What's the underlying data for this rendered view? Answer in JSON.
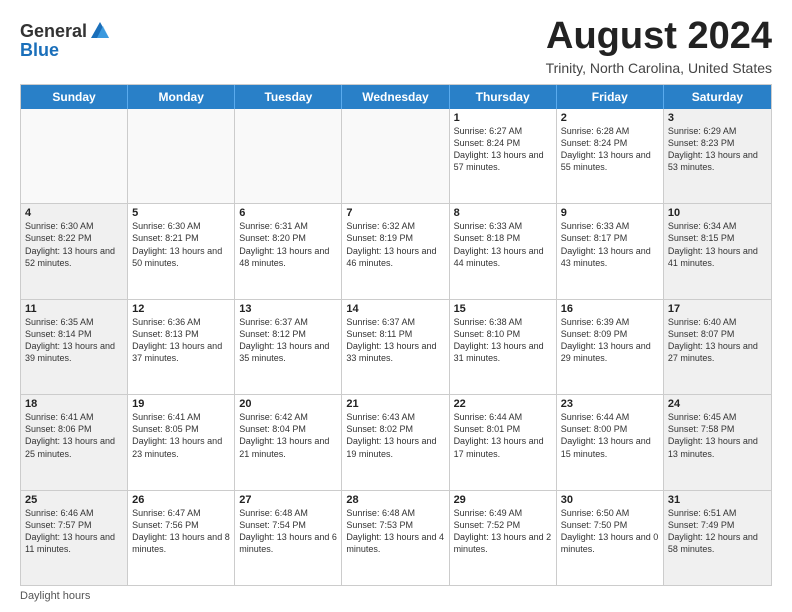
{
  "header": {
    "logo_line1": "General",
    "logo_line2": "Blue",
    "month_title": "August 2024",
    "location": "Trinity, North Carolina, United States"
  },
  "days_of_week": [
    "Sunday",
    "Monday",
    "Tuesday",
    "Wednesday",
    "Thursday",
    "Friday",
    "Saturday"
  ],
  "footer": {
    "daylight_label": "Daylight hours"
  },
  "weeks": [
    [
      {
        "day": "",
        "empty": true
      },
      {
        "day": "",
        "empty": true
      },
      {
        "day": "",
        "empty": true
      },
      {
        "day": "",
        "empty": true
      },
      {
        "day": "1",
        "sunrise": "Sunrise: 6:27 AM",
        "sunset": "Sunset: 8:24 PM",
        "daylight": "Daylight: 13 hours and 57 minutes."
      },
      {
        "day": "2",
        "sunrise": "Sunrise: 6:28 AM",
        "sunset": "Sunset: 8:24 PM",
        "daylight": "Daylight: 13 hours and 55 minutes."
      },
      {
        "day": "3",
        "sunrise": "Sunrise: 6:29 AM",
        "sunset": "Sunset: 8:23 PM",
        "daylight": "Daylight: 13 hours and 53 minutes.",
        "shaded": true
      }
    ],
    [
      {
        "day": "4",
        "sunrise": "Sunrise: 6:30 AM",
        "sunset": "Sunset: 8:22 PM",
        "daylight": "Daylight: 13 hours and 52 minutes.",
        "shaded": true
      },
      {
        "day": "5",
        "sunrise": "Sunrise: 6:30 AM",
        "sunset": "Sunset: 8:21 PM",
        "daylight": "Daylight: 13 hours and 50 minutes."
      },
      {
        "day": "6",
        "sunrise": "Sunrise: 6:31 AM",
        "sunset": "Sunset: 8:20 PM",
        "daylight": "Daylight: 13 hours and 48 minutes."
      },
      {
        "day": "7",
        "sunrise": "Sunrise: 6:32 AM",
        "sunset": "Sunset: 8:19 PM",
        "daylight": "Daylight: 13 hours and 46 minutes."
      },
      {
        "day": "8",
        "sunrise": "Sunrise: 6:33 AM",
        "sunset": "Sunset: 8:18 PM",
        "daylight": "Daylight: 13 hours and 44 minutes."
      },
      {
        "day": "9",
        "sunrise": "Sunrise: 6:33 AM",
        "sunset": "Sunset: 8:17 PM",
        "daylight": "Daylight: 13 hours and 43 minutes."
      },
      {
        "day": "10",
        "sunrise": "Sunrise: 6:34 AM",
        "sunset": "Sunset: 8:15 PM",
        "daylight": "Daylight: 13 hours and 41 minutes.",
        "shaded": true
      }
    ],
    [
      {
        "day": "11",
        "sunrise": "Sunrise: 6:35 AM",
        "sunset": "Sunset: 8:14 PM",
        "daylight": "Daylight: 13 hours and 39 minutes.",
        "shaded": true
      },
      {
        "day": "12",
        "sunrise": "Sunrise: 6:36 AM",
        "sunset": "Sunset: 8:13 PM",
        "daylight": "Daylight: 13 hours and 37 minutes."
      },
      {
        "day": "13",
        "sunrise": "Sunrise: 6:37 AM",
        "sunset": "Sunset: 8:12 PM",
        "daylight": "Daylight: 13 hours and 35 minutes."
      },
      {
        "day": "14",
        "sunrise": "Sunrise: 6:37 AM",
        "sunset": "Sunset: 8:11 PM",
        "daylight": "Daylight: 13 hours and 33 minutes."
      },
      {
        "day": "15",
        "sunrise": "Sunrise: 6:38 AM",
        "sunset": "Sunset: 8:10 PM",
        "daylight": "Daylight: 13 hours and 31 minutes."
      },
      {
        "day": "16",
        "sunrise": "Sunrise: 6:39 AM",
        "sunset": "Sunset: 8:09 PM",
        "daylight": "Daylight: 13 hours and 29 minutes."
      },
      {
        "day": "17",
        "sunrise": "Sunrise: 6:40 AM",
        "sunset": "Sunset: 8:07 PM",
        "daylight": "Daylight: 13 hours and 27 minutes.",
        "shaded": true
      }
    ],
    [
      {
        "day": "18",
        "sunrise": "Sunrise: 6:41 AM",
        "sunset": "Sunset: 8:06 PM",
        "daylight": "Daylight: 13 hours and 25 minutes.",
        "shaded": true
      },
      {
        "day": "19",
        "sunrise": "Sunrise: 6:41 AM",
        "sunset": "Sunset: 8:05 PM",
        "daylight": "Daylight: 13 hours and 23 minutes."
      },
      {
        "day": "20",
        "sunrise": "Sunrise: 6:42 AM",
        "sunset": "Sunset: 8:04 PM",
        "daylight": "Daylight: 13 hours and 21 minutes."
      },
      {
        "day": "21",
        "sunrise": "Sunrise: 6:43 AM",
        "sunset": "Sunset: 8:02 PM",
        "daylight": "Daylight: 13 hours and 19 minutes."
      },
      {
        "day": "22",
        "sunrise": "Sunrise: 6:44 AM",
        "sunset": "Sunset: 8:01 PM",
        "daylight": "Daylight: 13 hours and 17 minutes."
      },
      {
        "day": "23",
        "sunrise": "Sunrise: 6:44 AM",
        "sunset": "Sunset: 8:00 PM",
        "daylight": "Daylight: 13 hours and 15 minutes."
      },
      {
        "day": "24",
        "sunrise": "Sunrise: 6:45 AM",
        "sunset": "Sunset: 7:58 PM",
        "daylight": "Daylight: 13 hours and 13 minutes.",
        "shaded": true
      }
    ],
    [
      {
        "day": "25",
        "sunrise": "Sunrise: 6:46 AM",
        "sunset": "Sunset: 7:57 PM",
        "daylight": "Daylight: 13 hours and 11 minutes.",
        "shaded": true
      },
      {
        "day": "26",
        "sunrise": "Sunrise: 6:47 AM",
        "sunset": "Sunset: 7:56 PM",
        "daylight": "Daylight: 13 hours and 8 minutes."
      },
      {
        "day": "27",
        "sunrise": "Sunrise: 6:48 AM",
        "sunset": "Sunset: 7:54 PM",
        "daylight": "Daylight: 13 hours and 6 minutes."
      },
      {
        "day": "28",
        "sunrise": "Sunrise: 6:48 AM",
        "sunset": "Sunset: 7:53 PM",
        "daylight": "Daylight: 13 hours and 4 minutes."
      },
      {
        "day": "29",
        "sunrise": "Sunrise: 6:49 AM",
        "sunset": "Sunset: 7:52 PM",
        "daylight": "Daylight: 13 hours and 2 minutes."
      },
      {
        "day": "30",
        "sunrise": "Sunrise: 6:50 AM",
        "sunset": "Sunset: 7:50 PM",
        "daylight": "Daylight: 13 hours and 0 minutes."
      },
      {
        "day": "31",
        "sunrise": "Sunrise: 6:51 AM",
        "sunset": "Sunset: 7:49 PM",
        "daylight": "Daylight: 12 hours and 58 minutes.",
        "shaded": true
      }
    ]
  ]
}
